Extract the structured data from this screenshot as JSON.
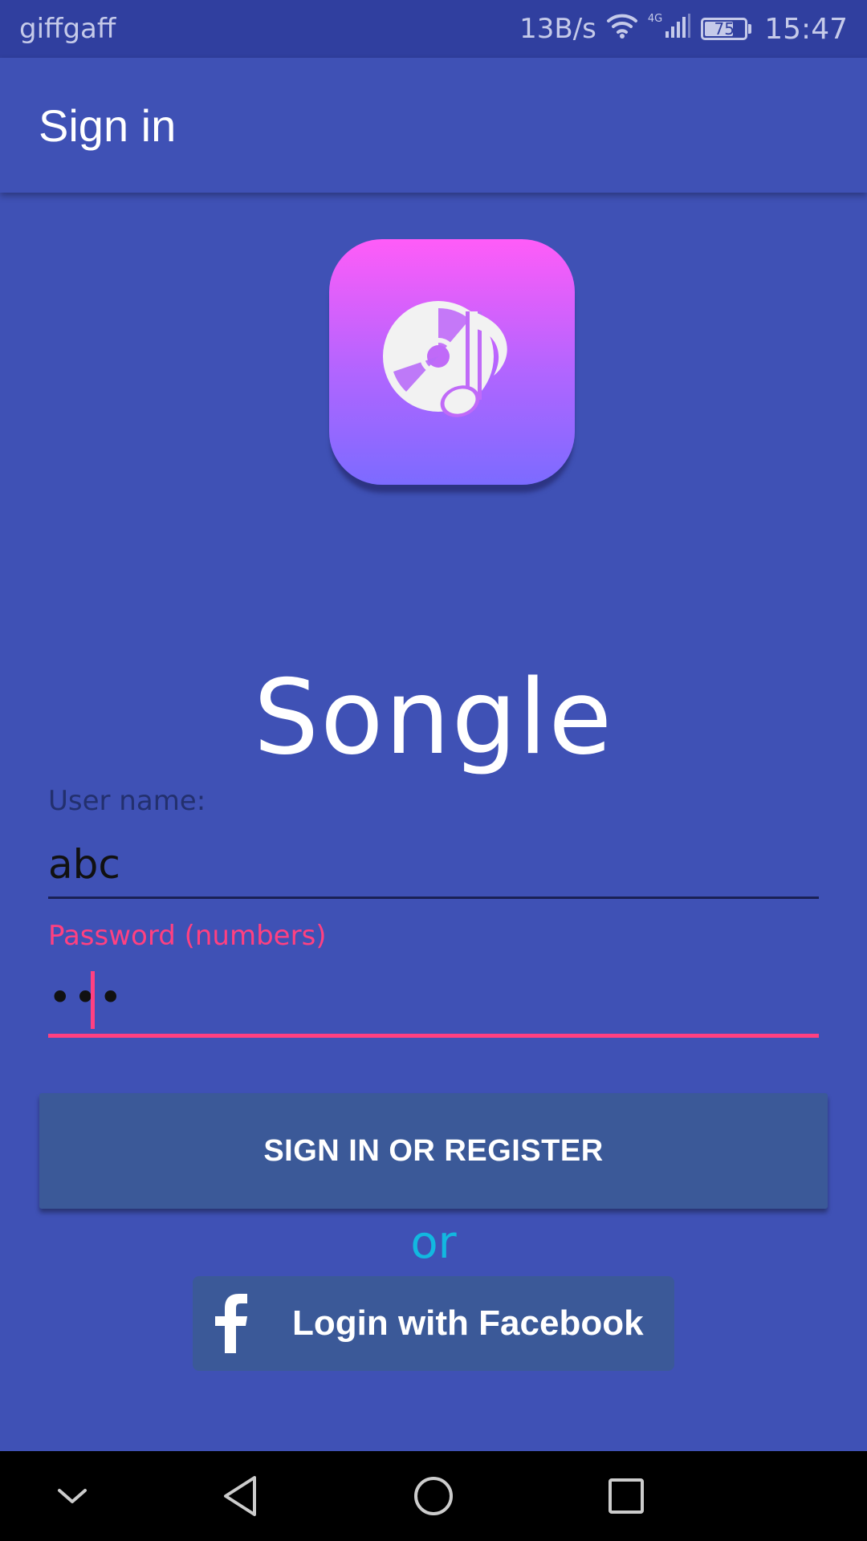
{
  "status_bar": {
    "carrier": "giffgaff",
    "net_speed": "13B/s",
    "network_type": "4G",
    "battery_level": "75",
    "battery_fraction": 0.75,
    "time": "15:47",
    "icons": [
      "wifi-icon",
      "signal-icon",
      "battery-icon"
    ]
  },
  "app_bar": {
    "title": "Sign in"
  },
  "logo": {
    "icon": "music-disc-icon",
    "gradient_top": "#FF5CF8",
    "gradient_bottom": "#7C6BFF"
  },
  "app_name": "Songle",
  "form": {
    "username_label": "User name:",
    "username_value": "abc",
    "password_label": "Password (numbers)",
    "password_value": "•••"
  },
  "buttons": {
    "signin_label": "SIGN IN OR REGISTER",
    "or_label": "or",
    "facebook_label": "Login with Facebook"
  },
  "nav_bar": {
    "items": [
      "collapse-icon",
      "back-icon",
      "home-icon",
      "recents-icon"
    ]
  },
  "colors": {
    "primary": "#3F51B5",
    "primary_dark": "#303F9F",
    "accent": "#FF4081",
    "facebook_blue": "#3B5998",
    "or_text": "#12B8E0"
  }
}
